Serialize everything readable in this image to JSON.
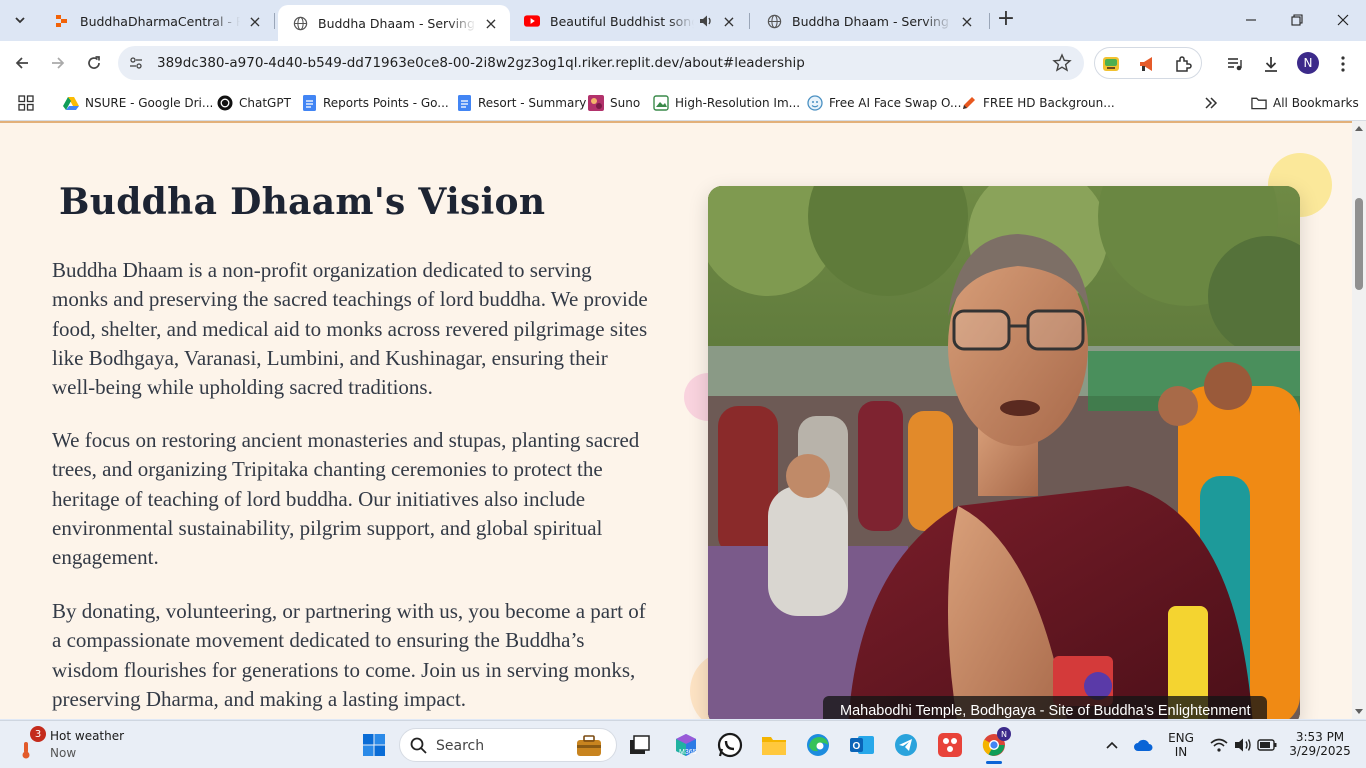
{
  "browser": {
    "tabs": [
      {
        "title": "BuddhaDharmaCentral - Replit",
        "active": false
      },
      {
        "title": "Buddha Dhaam - Serving Monk",
        "active": true
      },
      {
        "title": "Beautiful Buddhist song - Yo",
        "active": false,
        "audio": true
      },
      {
        "title": "Buddha Dhaam - Serving Monk",
        "active": false
      }
    ],
    "url": "389dc380-a970-4d40-b549-dd71963e0ce8-00-2i8w2gz3og1ql.riker.replit.dev/about#leadership",
    "profile_initial": "N"
  },
  "bookmarks": {
    "items": [
      {
        "label": "NSURE - Google Dri..."
      },
      {
        "label": "ChatGPT"
      },
      {
        "label": "Reports Points - Go..."
      },
      {
        "label": "Resort - Summary"
      },
      {
        "label": "Suno"
      },
      {
        "label": "High-Resolution Im..."
      },
      {
        "label": "Free AI Face Swap O..."
      },
      {
        "label": "FREE HD Backgroun..."
      }
    ],
    "all_bookmarks": "All Bookmarks"
  },
  "content": {
    "title": "Buddha Dhaam's Vision",
    "paragraphs": [
      "Buddha Dhaam is a non-profit organization dedicated to serving monks and preserving the sacred teachings of lord buddha. We provide food, shelter, and medical aid to monks across revered pilgrimage sites like Bodhgaya, Varanasi, Lumbini, and Kushinagar, ensuring their well-being while upholding sacred traditions.",
      "We focus on restoring ancient monasteries and stupas, planting sacred trees, and organizing Tripitaka chanting ceremonies to protect the heritage of teaching of lord buddha. Our initiatives also include environmental sustainability, pilgrim support, and global spiritual engagement.",
      "By donating, volunteering, or partnering with us, you become a part of a compassionate movement dedicated to ensuring the Buddha’s wisdom flourishes for generations to come. Join us in serving monks, preserving Dharma, and making a lasting impact."
    ],
    "photo_caption": "Mahabodhi Temple, Bodhgaya - Site of Buddha’s Enlightenment",
    "colors": {
      "background": "#fdf4ea",
      "heading": "#1d2433",
      "body_text": "#333a46",
      "accent_yellow": "#fbe89a",
      "accent_pink": "#f9d3de"
    }
  },
  "taskbar": {
    "weather": {
      "title": "Hot weather",
      "subtitle": "Now",
      "badge": "3"
    },
    "search_label": "Search",
    "language": {
      "line1": "ENG",
      "line2": "IN"
    },
    "time": "3:53 PM",
    "date": "3/29/2025",
    "chrome_badge": "N"
  }
}
